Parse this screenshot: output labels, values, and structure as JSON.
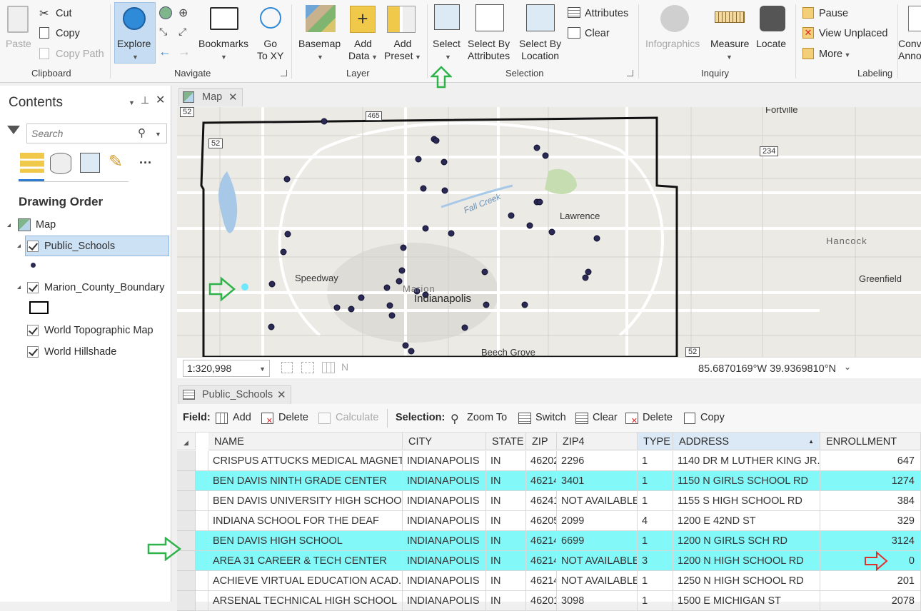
{
  "ribbon": {
    "clipboard": {
      "paste": "Paste",
      "cut": "Cut",
      "copy": "Copy",
      "copy_path": "Copy Path",
      "label": "Clipboard"
    },
    "navigate": {
      "explore": "Explore",
      "bookmarks": "Bookmarks",
      "goto_1": "Go",
      "goto_2": "To XY",
      "label": "Navigate"
    },
    "layer": {
      "basemap": "Basemap",
      "add_data_1": "Add",
      "add_data_2": "Data",
      "add_preset_1": "Add",
      "add_preset_2": "Preset",
      "label": "Layer"
    },
    "selection": {
      "select": "Select",
      "sba_1": "Select By",
      "sba_2": "Attributes",
      "sbl_1": "Select By",
      "sbl_2": "Location",
      "attributes": "Attributes",
      "clear": "Clear",
      "label": "Selection"
    },
    "inquiry": {
      "infographics": "Infographics",
      "measure": "Measure",
      "locate": "Locate",
      "label": "Inquiry"
    },
    "labeling": {
      "pause": "Pause",
      "view_unplaced": "View Unplaced",
      "more": "More",
      "label": "Labeling",
      "conv_1": "Conv",
      "conv_2": "Anno"
    }
  },
  "contents": {
    "title": "Contents",
    "search_placeholder": "Search",
    "drawing_order": "Drawing Order",
    "map": "Map",
    "layers": [
      "Public_Schools",
      "Marion_County_Boundary",
      "World Topographic Map",
      "World Hillshade"
    ]
  },
  "map": {
    "tab": "Map",
    "scale": "1:320,998",
    "coords": "85.6870169°W 39.9369810°N",
    "labels": {
      "fortville": "Fortville",
      "lawrence": "Lawrence",
      "hancock": "Hancock",
      "greenfield": "Greenfield",
      "speedway": "Speedway",
      "marion": "Marion",
      "indianapolis": "Indianapolis",
      "beech_grove": "Beech Grove",
      "fall_creek": "Fall Creek",
      "h52": "52",
      "h52b": "52",
      "h465": "465",
      "h234": "234",
      "h52c": "52"
    }
  },
  "table": {
    "tab": "Public_Schools",
    "field_label": "Field:",
    "add": "Add",
    "delete": "Delete",
    "calculate": "Calculate",
    "selection_label": "Selection:",
    "zoom_to": "Zoom To",
    "switch": "Switch",
    "clear": "Clear",
    "delete2": "Delete",
    "copy": "Copy",
    "columns": [
      "NAME",
      "CITY",
      "STATE",
      "ZIP",
      "ZIP4",
      "TYPE",
      "ADDRESS",
      "ENROLLMENT"
    ],
    "rows": [
      {
        "name": "CRISPUS ATTUCKS MEDICAL MAGNET...",
        "city": "INDIANAPOLIS",
        "state": "IN",
        "zip": "46202",
        "zip4": "2296",
        "type": "1",
        "address": "1140 DR M LUTHER KING JR...",
        "enrollment": "647",
        "selected": false
      },
      {
        "name": "BEN DAVIS NINTH GRADE CENTER",
        "city": "INDIANAPOLIS",
        "state": "IN",
        "zip": "46214",
        "zip4": "3401",
        "type": "1",
        "address": "1150 N GIRLS SCHOOL RD",
        "enrollment": "1274",
        "selected": true
      },
      {
        "name": "BEN DAVIS UNIVERSITY HIGH SCHOOL",
        "city": "INDIANAPOLIS",
        "state": "IN",
        "zip": "46241",
        "zip4": "NOT AVAILABLE",
        "type": "1",
        "address": "1155 S HIGH SCHOOL RD",
        "enrollment": "384",
        "selected": false
      },
      {
        "name": "INDIANA SCHOOL FOR THE DEAF",
        "city": "INDIANAPOLIS",
        "state": "IN",
        "zip": "46205",
        "zip4": "2099",
        "type": "4",
        "address": "1200 E 42ND ST",
        "enrollment": "329",
        "selected": false
      },
      {
        "name": "BEN DAVIS HIGH SCHOOL",
        "city": "INDIANAPOLIS",
        "state": "IN",
        "zip": "46214",
        "zip4": "6699",
        "type": "1",
        "address": "1200 N GIRLS SCH RD",
        "enrollment": "3124",
        "selected": true
      },
      {
        "name": "AREA 31 CAREER & TECH CENTER",
        "city": "INDIANAPOLIS",
        "state": "IN",
        "zip": "46214",
        "zip4": "NOT AVAILABLE",
        "type": "3",
        "address": "1200 N HIGH SCHOOL RD",
        "enrollment": "0",
        "selected": true
      },
      {
        "name": "ACHIEVE VIRTUAL EDUCATION ACAD...",
        "city": "INDIANAPOLIS",
        "state": "IN",
        "zip": "46214",
        "zip4": "NOT AVAILABLE",
        "type": "1",
        "address": "1250 N HIGH SCHOOL RD",
        "enrollment": "201",
        "selected": false
      },
      {
        "name": "ARSENAL TECHNICAL HIGH SCHOOL",
        "city": "INDIANAPOLIS",
        "state": "IN",
        "zip": "46201",
        "zip4": "3098",
        "type": "1",
        "address": "1500 E MICHIGAN ST",
        "enrollment": "2078",
        "selected": false
      }
    ]
  },
  "colors": {
    "selection": "#82f8f8",
    "annotation_green": "#2db34a",
    "annotation_red": "#e03030",
    "point": "#2a2a55"
  }
}
